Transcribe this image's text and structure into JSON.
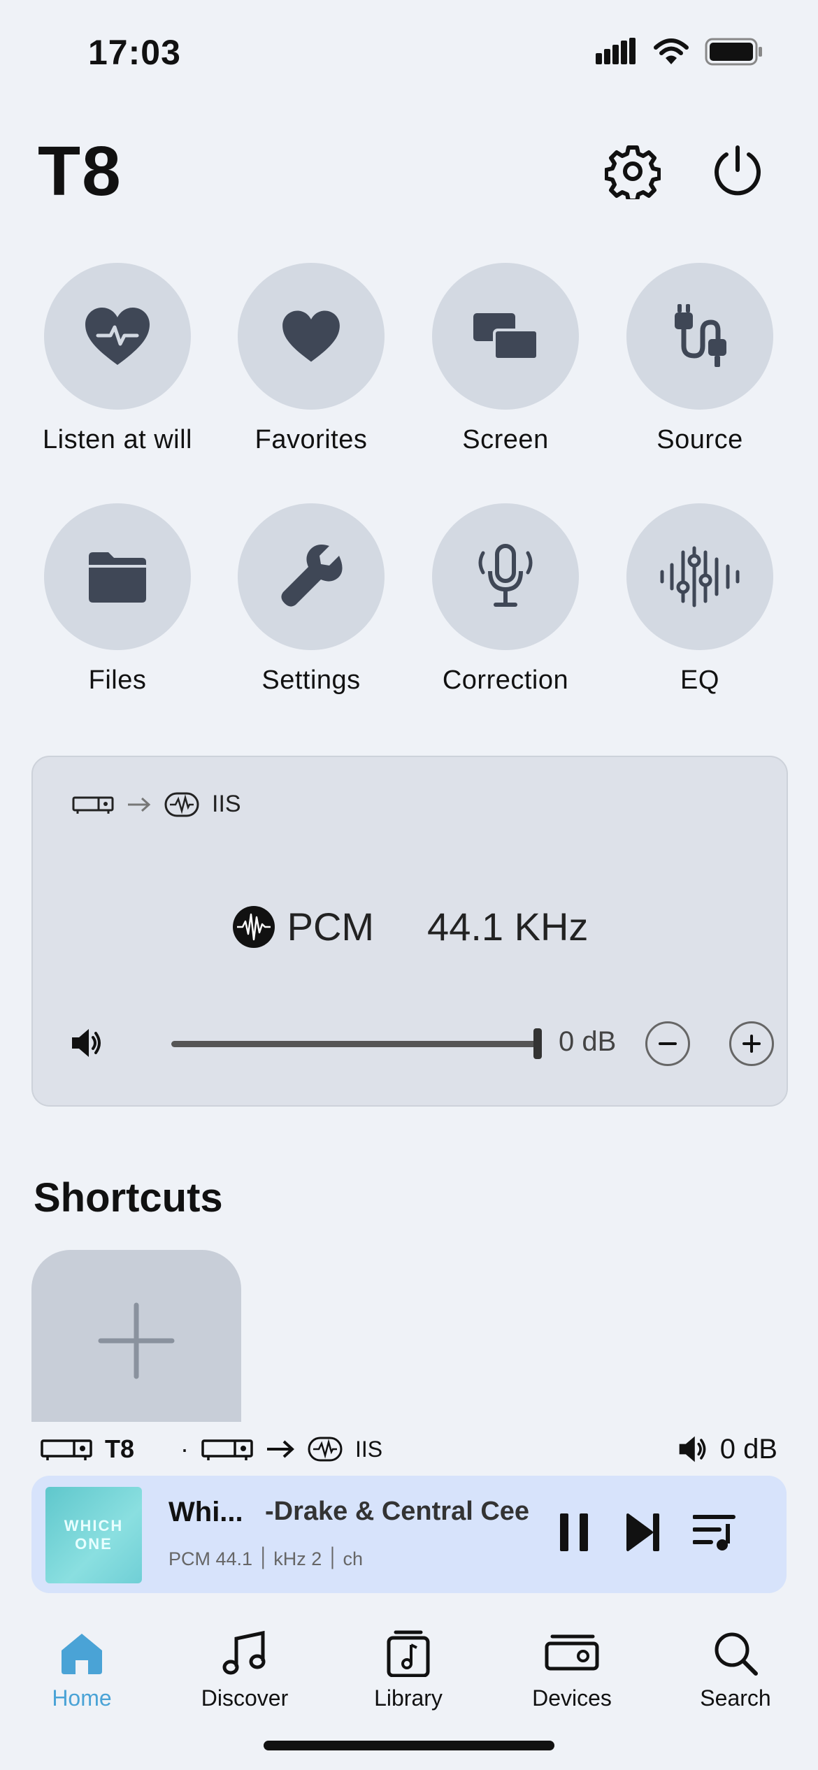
{
  "status_bar": {
    "time": "17:03"
  },
  "header": {
    "title": "T8"
  },
  "quick_actions": [
    {
      "label": "Listen at will",
      "icon": "heart-pulse-icon"
    },
    {
      "label": "Favorites",
      "icon": "heart-icon"
    },
    {
      "label": "Screen",
      "icon": "screen-icon"
    },
    {
      "label": "Source",
      "icon": "cable-icon"
    },
    {
      "label": "Files",
      "icon": "folder-icon"
    },
    {
      "label": "Settings",
      "icon": "wrench-icon"
    },
    {
      "label": "Correction",
      "icon": "microphone-icon"
    },
    {
      "label": "EQ",
      "icon": "equalizer-icon"
    }
  ],
  "status_card": {
    "output": "IIS",
    "format": "PCM",
    "sample_rate": "44.1 KHz",
    "volume_db": "0 dB",
    "volume_level": 1.0
  },
  "shortcuts": {
    "title": "Shortcuts"
  },
  "mini_bar": {
    "device": "T8",
    "separator": "·",
    "output": "IIS",
    "volume": "0 dB"
  },
  "now_playing": {
    "album_art_text_1": "WHICH",
    "album_art_text_2": "ONE",
    "title": "Whi...",
    "artist": "-Drake & Central Cee",
    "meta": "PCM ׀ 44.1 kHz ׀ 2 ch"
  },
  "tabs": [
    {
      "label": "Home",
      "active": true
    },
    {
      "label": "Discover",
      "active": false
    },
    {
      "label": "Library",
      "active": false
    },
    {
      "label": "Devices",
      "active": false
    },
    {
      "label": "Search",
      "active": false
    }
  ],
  "colors": {
    "accent": "#4aa3d6",
    "tile": "#d3d9e2",
    "icon": "#3f4756",
    "player_bg": "#d7e3fb"
  }
}
